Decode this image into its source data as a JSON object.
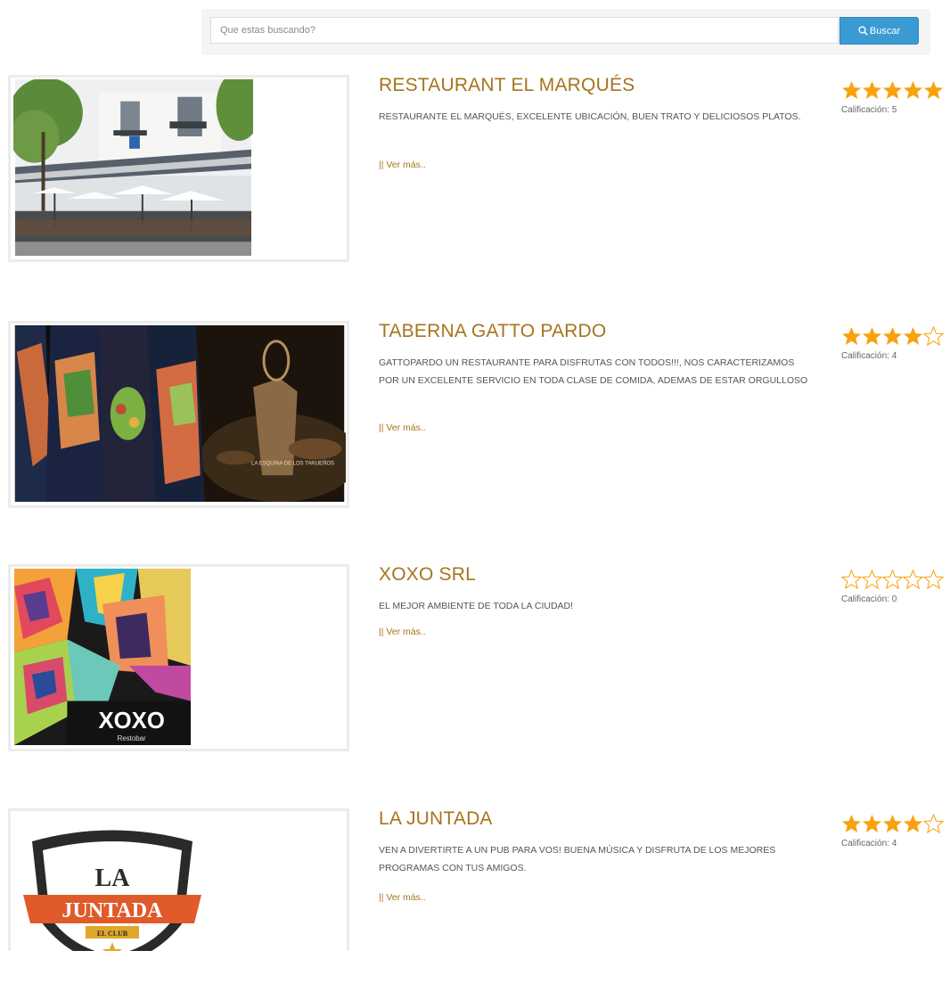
{
  "search": {
    "placeholder": "Que estas buscando?",
    "button_label": "Buscar"
  },
  "rating_prefix": "Calificación:",
  "star_color": "#f7a20e",
  "title_color": "#a6741d",
  "items": [
    {
      "title": "RESTAURANT EL MARQUÉS",
      "description": "RESTAURANTE EL MARQUÉS, EXCELENTE UBICACIÓN, BUEN TRATO Y DELICIOSOS PLATOS.",
      "more": "|| Ver más..",
      "rating": 5,
      "rating_label": "Calificación: 5"
    },
    {
      "title": "TABERNA GATTO PARDO",
      "description": "GATTOPARDO UN RESTAURANTE PARA DISFRUTAS CON TODOS!!!, NOS CARACTERIZAMOS POR UN EXCELENTE SERVICIO EN TODA CLASE DE COMIDA, ADEMAS DE ESTAR ORGULLOSO",
      "more": "|| Ver más..",
      "rating": 4,
      "rating_label": "Calificación: 4",
      "image_text": "LA ESQUINA DE LOS TARIJEÑOS"
    },
    {
      "title": "XOXO SRL",
      "description": "EL MEJOR AMBIENTE DE TODA LA CIUDAD!",
      "more": "|| Ver más..",
      "rating": 0,
      "rating_label": "Calificación: 0",
      "logo_text": "XOXO",
      "logo_sub": "Restobar"
    },
    {
      "title": "LA JUNTADA",
      "description": "VEN A DIVERTIRTE A UN PUB PARA VOS! BUENA MÚSICA Y DISFRUTA DE LOS MEJORES PROGRAMAS CON TUS AMIGOS.",
      "more": "|| Ver más..",
      "rating": 4,
      "rating_label": "Calificación: 4",
      "logo_top": "LA",
      "logo_main": "JUNTADA",
      "logo_sub": "EL CLUB"
    }
  ]
}
